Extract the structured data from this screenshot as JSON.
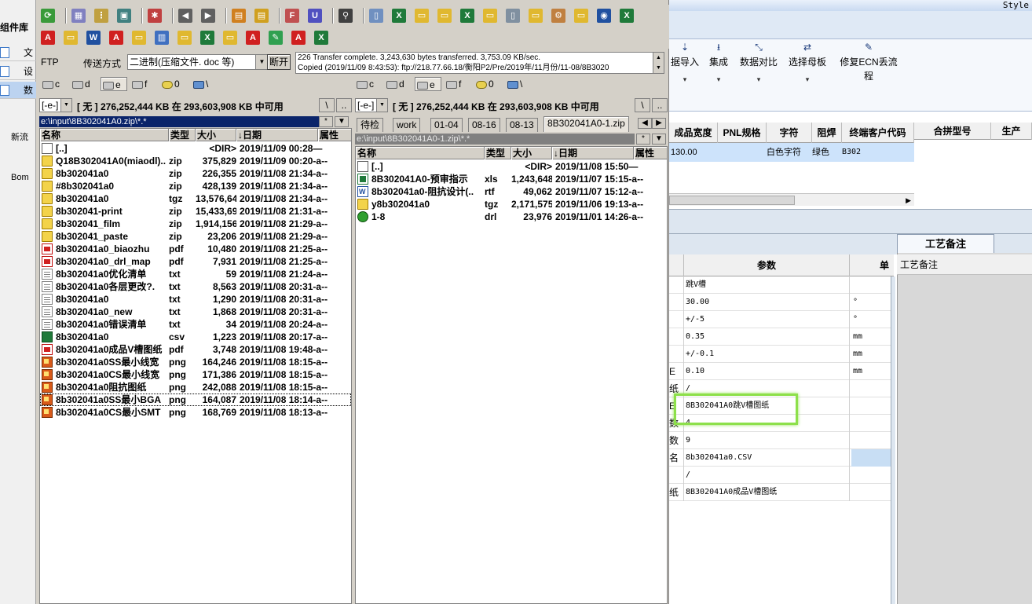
{
  "bg_app": {
    "style_label": "Style",
    "left": {
      "header": "组件库",
      "nav": [
        "文",
        "设",
        "数"
      ],
      "desktop": [
        "新流",
        "Bom"
      ]
    },
    "ribbon": [
      {
        "label": "据导入",
        "icon": "import-icon"
      },
      {
        "label": "集成",
        "icon": "download-icon"
      },
      {
        "label": "数据对比",
        "icon": "compare-icon"
      },
      {
        "label": "选择母板",
        "icon": "shuffle-icon"
      },
      {
        "label": "修复ECN丢流程",
        "icon": "wrench-icon"
      }
    ],
    "grid": {
      "headers": [
        "成品宽度",
        "PNL规格",
        "字符",
        "阻焊",
        "终端客户代码"
      ],
      "row": [
        "130.00",
        "",
        "白色字符",
        "绿色",
        "B302"
      ],
      "headers2": [
        "合拼型号",
        "生产"
      ]
    },
    "param_tab": "工艺备注",
    "gongyi_header": "工艺备注",
    "param_headers": {
      "param": "参数",
      "unit": "单"
    },
    "param_rows": [
      {
        "k": "",
        "v": "跳V槽",
        "u": ""
      },
      {
        "k": "",
        "v": "30.00",
        "u": "°"
      },
      {
        "k": "",
        "v": "+/-5",
        "u": "°"
      },
      {
        "k": "",
        "v": "0.35",
        "u": "mm"
      },
      {
        "k": "",
        "v": "+/-0.1",
        "u": "mm"
      },
      {
        "k": "E",
        "v": "0.10",
        "u": "mm"
      },
      {
        "k": "纸",
        "v": "/",
        "u": ""
      },
      {
        "k": "E",
        "v": "8B302041A0跳V槽图纸",
        "u": ""
      },
      {
        "k": "数",
        "v": "4",
        "u": ""
      },
      {
        "k": "数",
        "v": "9",
        "u": ""
      },
      {
        "k": "名",
        "v": "8b302041a0.CSV",
        "u": "",
        "u_blue": true
      },
      {
        "k": "",
        "v": "/",
        "u": ""
      },
      {
        "k": "纸",
        "v": "8B302041A0成品V槽图纸",
        "u": ""
      }
    ]
  },
  "tc": {
    "ftp": {
      "label": "FTP",
      "mode_label": "传送方式",
      "mode_value": "二进制(压缩文件. doc 等)",
      "disconnect": "断开",
      "log": [
        "226 Transfer complete. 3,243,630 bytes transferred. 3,753.09 KB/sec.",
        "Copied (2019/11/09 8:43:53): ftp://218.77.66.18/衡阳P2/Pre/2019年/11月份/11-08/8B3020"
      ]
    },
    "drives": [
      "c",
      "d",
      "e",
      "f",
      "0",
      "\\"
    ],
    "left": {
      "drive_sel": "[-e-]",
      "info": "[ 无 ]  276,252,444 KB 在 293,603,908 KB 中可用",
      "path": "e:\\input\\8B302041A0.zip\\*.*",
      "col_name": "名称",
      "col_type": "类型",
      "col_size": "大小",
      "col_date": "↓日期",
      "col_attr": "属性",
      "files": [
        {
          "icon": "up",
          "name": "[..]",
          "type": "",
          "size": "<DIR>",
          "date": "2019/11/09 00:28—"
        },
        {
          "icon": "folder",
          "name": "Q18B302041A0(miaodl)..",
          "type": "zip",
          "size": "375,829",
          "date": "2019/11/09 00:20-a--"
        },
        {
          "icon": "folder",
          "name": "8b302041a0",
          "type": "zip",
          "size": "226,355",
          "date": "2019/11/08 21:34-a--"
        },
        {
          "icon": "folder",
          "name": "#8b302041a0",
          "type": "zip",
          "size": "428,139",
          "date": "2019/11/08 21:34-a--"
        },
        {
          "icon": "folder",
          "name": "8b302041a0",
          "type": "tgz",
          "size": "13,576,641",
          "date": "2019/11/08 21:34-a--"
        },
        {
          "icon": "folder",
          "name": "8b302041-print",
          "type": "zip",
          "size": "15,433,690",
          "date": "2019/11/08 21:31-a--"
        },
        {
          "icon": "folder",
          "name": "8b302041_film",
          "type": "zip",
          "size": "1,914,156",
          "date": "2019/11/08 21:29-a--"
        },
        {
          "icon": "folder",
          "name": "8b302041_paste",
          "type": "zip",
          "size": "23,206",
          "date": "2019/11/08 21:29-a--"
        },
        {
          "icon": "pdf",
          "name": "8b302041a0_biaozhu",
          "type": "pdf",
          "size": "10,480",
          "date": "2019/11/08 21:25-a--"
        },
        {
          "icon": "pdf",
          "name": "8b302041a0_drl_map",
          "type": "pdf",
          "size": "7,931",
          "date": "2019/11/08 21:25-a--"
        },
        {
          "icon": "txt",
          "name": "8b302041a0优化清单",
          "type": "txt",
          "size": "59",
          "date": "2019/11/08 21:24-a--"
        },
        {
          "icon": "txt",
          "name": "8b302041a0各层更改?.",
          "type": "txt",
          "size": "8,563",
          "date": "2019/11/08 20:31-a--"
        },
        {
          "icon": "txt",
          "name": "8b302041a0",
          "type": "txt",
          "size": "1,290",
          "date": "2019/11/08 20:31-a--"
        },
        {
          "icon": "txt",
          "name": "8b302041a0_new",
          "type": "txt",
          "size": "1,868",
          "date": "2019/11/08 20:31-a--"
        },
        {
          "icon": "txt",
          "name": "8b302041a0错误清单",
          "type": "txt",
          "size": "34",
          "date": "2019/11/08 20:24-a--"
        },
        {
          "icon": "csv",
          "name": "8b302041a0",
          "type": "csv",
          "size": "1,223",
          "date": "2019/11/08 20:17-a--"
        },
        {
          "icon": "pdf",
          "name": "8b302041a0成品V槽图纸",
          "type": "pdf",
          "size": "3,748",
          "date": "2019/11/08 19:48-a--"
        },
        {
          "icon": "png",
          "name": "8b302041a0SS最小线宽",
          "type": "png",
          "size": "164,246",
          "date": "2019/11/08 18:15-a--"
        },
        {
          "icon": "png",
          "name": "8b302041a0CS最小线宽",
          "type": "png",
          "size": "171,386",
          "date": "2019/11/08 18:15-a--"
        },
        {
          "icon": "png",
          "name": "8b302041a0阻抗图纸",
          "type": "png",
          "size": "242,088",
          "date": "2019/11/08 18:15-a--"
        },
        {
          "icon": "png",
          "name": "8b302041a0SS最小BGA",
          "type": "png",
          "size": "164,087",
          "date": "2019/11/08 18:14-a--",
          "cursor": true
        },
        {
          "icon": "png",
          "name": "8b302041a0CS最小SMT",
          "type": "png",
          "size": "168,769",
          "date": "2019/11/08 18:13-a--"
        }
      ]
    },
    "right": {
      "drive_sel": "[-e-]",
      "info": "[ 无 ]  276,252,444 KB 在 293,603,908 KB 中可用",
      "path": "e:\\input\\8B302041A0-1.zip\\*.*",
      "tabs": [
        "待检",
        "work",
        "01-04",
        "08-16",
        "08-13",
        "8B302041A0-1.zip"
      ],
      "col_name": "名称",
      "col_type": "类型",
      "col_size": "大小",
      "col_date": "↓日期",
      "col_attr": "属性",
      "files": [
        {
          "icon": "up",
          "name": "[..]",
          "type": "",
          "size": "<DIR>",
          "date": "2019/11/08 15:50—"
        },
        {
          "icon": "xls",
          "name": "8B302041A0-预审指示",
          "type": "xls",
          "size": "1,243,648",
          "date": "2019/11/07 15:15-a--"
        },
        {
          "icon": "rtf",
          "name": "8b302041a0-阻抗设计(..",
          "type": "rtf",
          "size": "49,062",
          "date": "2019/11/07 15:12-a--"
        },
        {
          "icon": "folder",
          "name": "y8b302041a0",
          "type": "tgz",
          "size": "2,171,575",
          "date": "2019/11/06 19:13-a--"
        },
        {
          "icon": "drl",
          "name": "1-8",
          "type": "drl",
          "size": "23,976",
          "date": "2019/11/01 14:26-a--"
        }
      ]
    }
  },
  "colors": {
    "active_path": "#0a246a",
    "highlight_box": "#8de04a"
  }
}
